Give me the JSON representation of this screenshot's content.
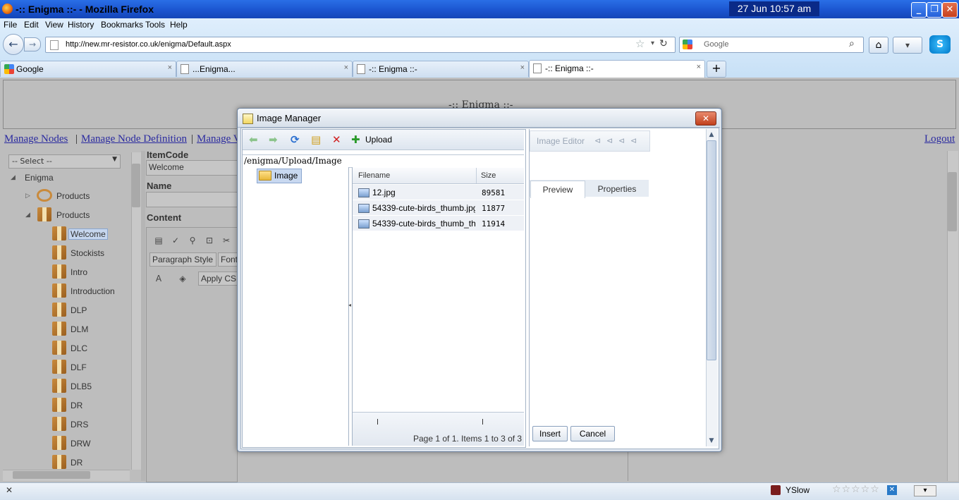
{
  "window": {
    "title": "-:: Enigma ::- - Mozilla Firefox",
    "clock": "27 Jun   10:57 am",
    "controls": {
      "minimize": "_",
      "maximize": "❐",
      "close": "✕"
    }
  },
  "menu": [
    "File",
    "Edit",
    "View",
    "History",
    "Bookmarks",
    "Tools",
    "Help"
  ],
  "navbar": {
    "back": "←",
    "forward": "→",
    "url": "http://new.mr-resistor.co.uk/enigma/Default.aspx",
    "star": "☆",
    "dropdown": "▾",
    "reload": "↻",
    "search_placeholder": "Google",
    "search_go": "⌕",
    "home": "⌂",
    "addon": "▾",
    "skype": "S"
  },
  "tabs": [
    {
      "label": "Google",
      "close": "×",
      "icon": "google-icon"
    },
    {
      "label": "...Enigma...",
      "close": "×",
      "icon": "page-icon"
    },
    {
      "label": "-:: Enigma ::-",
      "close": "×",
      "icon": "page-icon"
    },
    {
      "label": "-:: Enigma ::-",
      "close": "×",
      "icon": "page-icon",
      "active": true
    }
  ],
  "new_tab": "+",
  "page": {
    "heading": "-:: Enigma ::-",
    "nav_links": [
      "Manage Nodes",
      "Manage Node Definition",
      "Manage V"
    ],
    "separator": "|",
    "logout": "Logout",
    "select": {
      "value": "-- Select --",
      "arrow": "▼"
    },
    "tree": {
      "root": "Enigma",
      "expand": "◢",
      "collapsed": "▷",
      "nodes": [
        {
          "label": "Products",
          "level": 1
        },
        {
          "label": "Products",
          "level": 1
        },
        {
          "label": "Welcome",
          "level": 2,
          "selected": true
        },
        {
          "label": "Stockists",
          "level": 2
        },
        {
          "label": "Intro",
          "level": 2
        },
        {
          "label": "Introduction",
          "level": 2
        },
        {
          "label": "DLP",
          "level": 2
        },
        {
          "label": "DLM",
          "level": 2
        },
        {
          "label": "DLC",
          "level": 2
        },
        {
          "label": "DLF",
          "level": 2
        },
        {
          "label": "DLB5",
          "level": 2
        },
        {
          "label": "DR",
          "level": 2
        },
        {
          "label": "DRS",
          "level": 2
        },
        {
          "label": "DRW",
          "level": 2
        },
        {
          "label": "DR",
          "level": 2
        }
      ]
    },
    "editor": {
      "itemcode_label": "ItemCode",
      "itemcode_value": "Welcome",
      "name_label": "Name",
      "content_label": "Content",
      "paragraph_style": "Paragraph Style",
      "font": "Font",
      "apply_css": "Apply CS"
    }
  },
  "dialog": {
    "title": "Image Manager",
    "close": "✕",
    "toolbar": {
      "back": "⬅",
      "forward": "➡",
      "refresh": "⟳",
      "new_folder": "▤",
      "delete": "✕",
      "upload": "Upload",
      "upload_icon": "✚"
    },
    "path": "/enigma/Upload/Image",
    "folder": "Image",
    "grid": {
      "columns": [
        "Filename",
        "Size"
      ],
      "rows": [
        {
          "name": "12.jpg",
          "size": "89581"
        },
        {
          "name": "54339-cute-birds_thumb.jpg",
          "size": "11877"
        },
        {
          "name": "54339-cute-birds_thumb_th",
          "size": "11914"
        }
      ]
    },
    "pager": "Page 1 of 1. Items 1 to 3 of 3",
    "image_editor": "Image Editor",
    "image_editor_arrows": [
      "⊲",
      "⊲",
      "⊲",
      "⊲"
    ],
    "tabs": [
      "Preview",
      "Properties"
    ],
    "buttons": {
      "insert": "Insert",
      "cancel": "Cancel"
    },
    "scroll_up": "▲",
    "scroll_down": "▼"
  },
  "statusbar": {
    "close": "✕",
    "yslow": "YSlow",
    "stars": "☆☆☆☆☆"
  }
}
